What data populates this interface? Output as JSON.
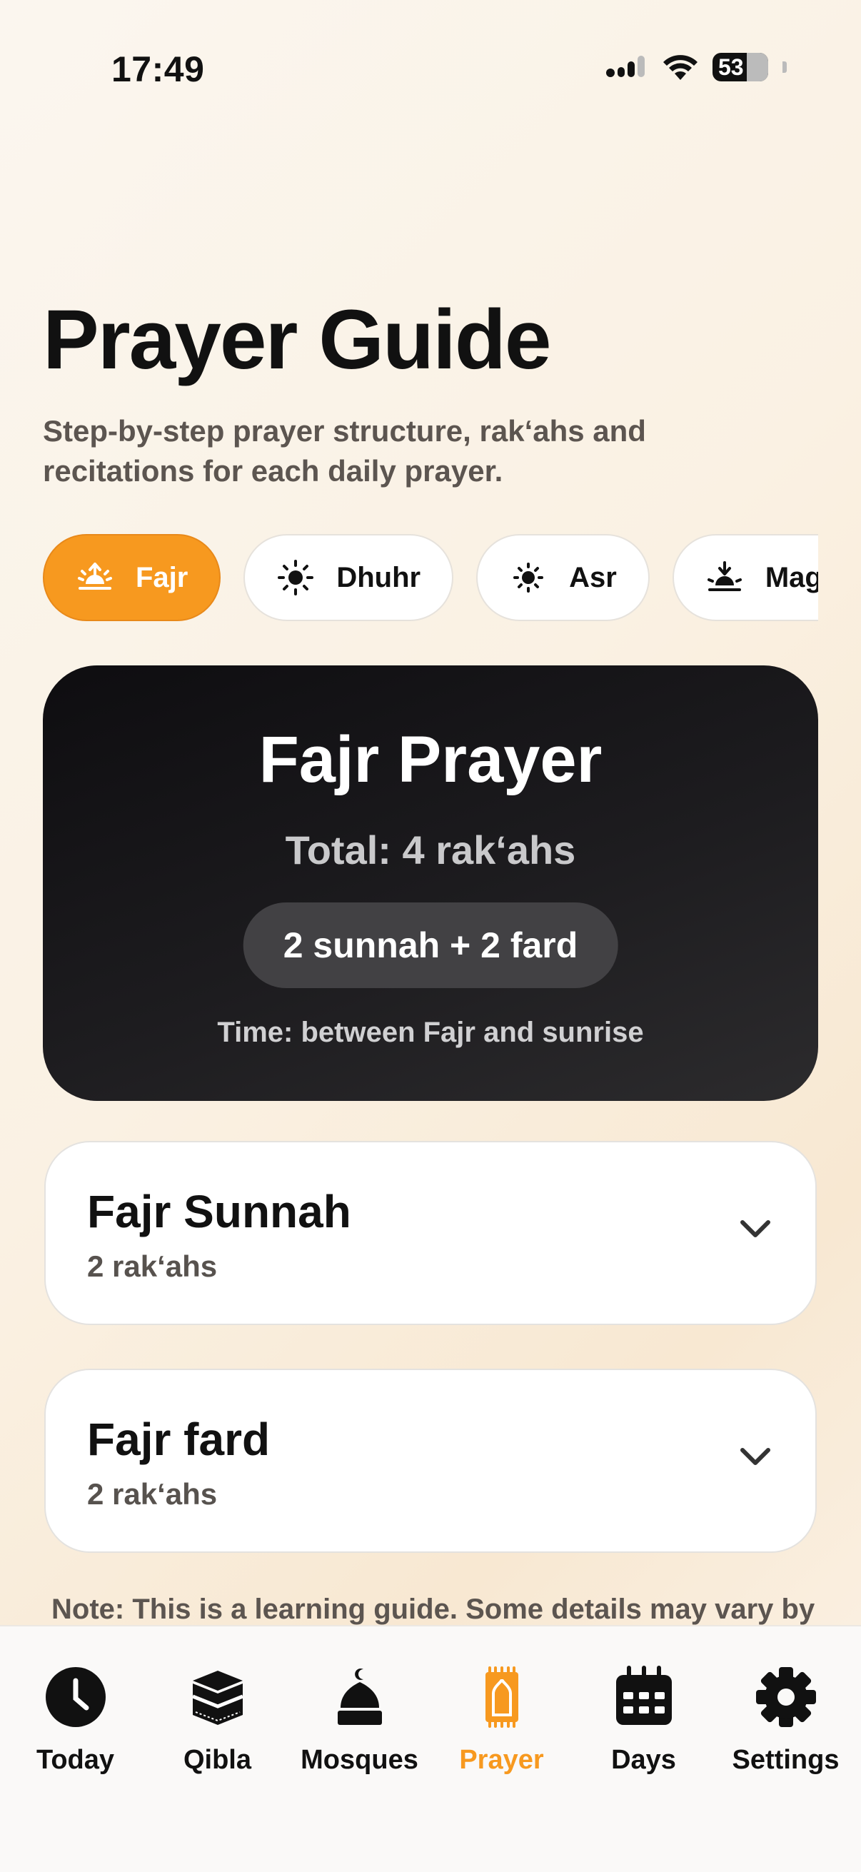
{
  "status_bar": {
    "time": "17:49",
    "battery": "53"
  },
  "header": {
    "title": "Prayer Guide",
    "subtitle": "Step-by-step prayer structure, rak‘ahs and recitations for each daily prayer."
  },
  "prayer_chips": [
    {
      "label": "Fajr",
      "icon": "sunrise-icon",
      "active": true
    },
    {
      "label": "Dhuhr",
      "icon": "sun-icon",
      "active": false
    },
    {
      "label": "Asr",
      "icon": "sun-small-icon",
      "active": false
    },
    {
      "label": "Maghrib",
      "icon": "sunset-icon",
      "active": false
    }
  ],
  "hero": {
    "title": "Fajr Prayer",
    "total": "Total: 4 rak‘ahs",
    "breakdown": "2 sunnah + 2 fard",
    "time": "Time: between Fajr and sunrise"
  },
  "sections": [
    {
      "title": "Fajr Sunnah",
      "subtitle": "2 rak‘ahs"
    },
    {
      "title": "Fajr fard",
      "subtitle": "2 rak‘ahs"
    }
  ],
  "note": "Note: This is a learning guide. Some details may vary by",
  "tabs": [
    {
      "label": "Today",
      "icon": "clock-icon"
    },
    {
      "label": "Qibla",
      "icon": "kaaba-icon"
    },
    {
      "label": "Mosques",
      "icon": "mosque-icon"
    },
    {
      "label": "Prayer",
      "icon": "prayer-mat-icon",
      "active": true
    },
    {
      "label": "Days",
      "icon": "calendar-icon"
    },
    {
      "label": "Settings",
      "icon": "gear-icon"
    }
  ],
  "colors": {
    "accent": "#f7991f",
    "dark_card": "#1d1c1f",
    "background": "#faf1e3"
  }
}
